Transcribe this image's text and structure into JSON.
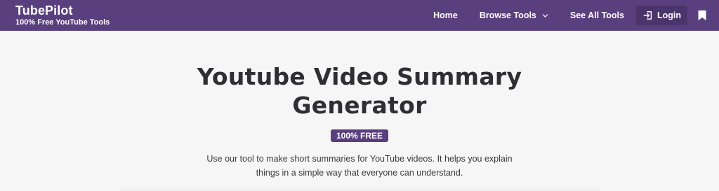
{
  "brand": {
    "name": "TubePilot",
    "tagline": "100% Free YouTube Tools"
  },
  "nav": {
    "home": "Home",
    "browse_tools": "Browse Tools",
    "see_all_tools": "See All Tools",
    "login": "Login"
  },
  "icons": {
    "browse_chevron": "chevron-down-icon",
    "login": "login-icon",
    "bookmark": "bookmark-icon"
  },
  "hero": {
    "title": "Youtube Video Summary Generator",
    "badge": "100% FREE",
    "description": "Use our tool to make short summaries for YouTube videos. It helps you explain things in a simple way that everyone can understand."
  },
  "colors": {
    "brand_purple": "#5a3f7e",
    "login_button_bg": "#4b336b",
    "page_bg": "#f6f6f6",
    "heading_text": "#2f2f33"
  }
}
